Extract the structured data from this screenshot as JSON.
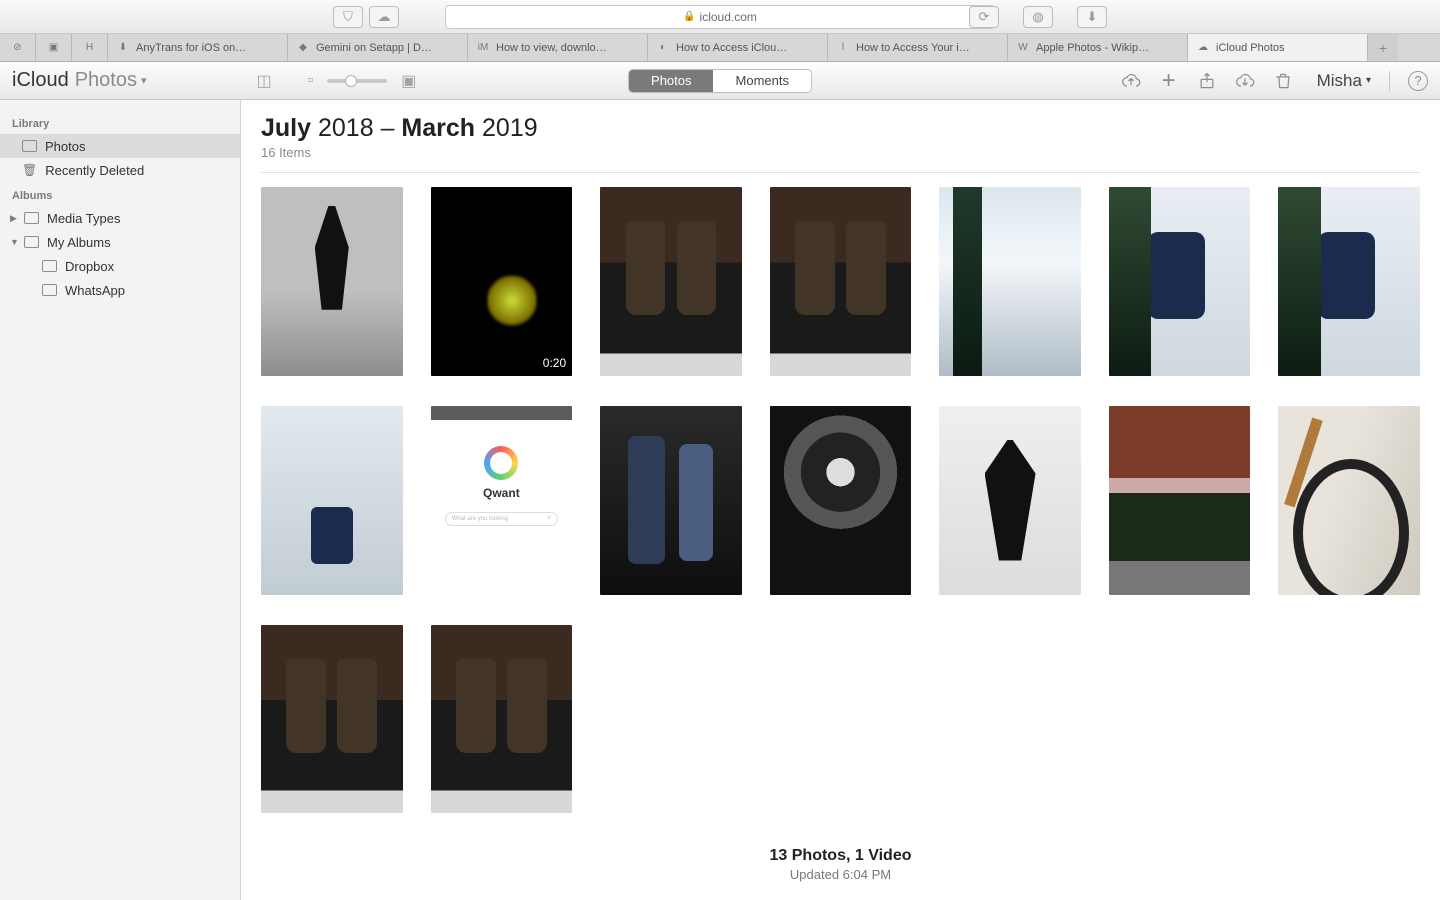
{
  "browser": {
    "url_host": "icloud.com",
    "tabs": [
      {
        "label": "",
        "icon": "⊘"
      },
      {
        "label": "",
        "icon": "▣"
      },
      {
        "label": "",
        "icon": "H"
      },
      {
        "label": "AnyTrans for iOS on…",
        "icon": "⬇"
      },
      {
        "label": "Gemini on Setapp | D…",
        "icon": "◆"
      },
      {
        "label": "How to view, downlo…",
        "icon": "iM"
      },
      {
        "label": "How to Access iClou…",
        "icon": "◐"
      },
      {
        "label": "How to Access Your i…",
        "icon": "l"
      },
      {
        "label": "Apple Photos - Wikip…",
        "icon": "W"
      },
      {
        "label": "iCloud Photos",
        "icon": "☁",
        "active": true
      }
    ]
  },
  "app": {
    "brand": "iCloud",
    "section": "Photos",
    "segmented": {
      "photos": "Photos",
      "moments": "Moments"
    },
    "user": "Misha"
  },
  "sidebar": {
    "library_label": "Library",
    "photos": "Photos",
    "recently_deleted": "Recently Deleted",
    "albums_label": "Albums",
    "media_types": "Media Types",
    "my_albums": "My Albums",
    "children": [
      {
        "label": "Dropbox"
      },
      {
        "label": "WhatsApp"
      }
    ]
  },
  "range": {
    "m1": "July",
    "y1": "2018",
    "dash": "–",
    "m2": "March",
    "y2": "2019",
    "count": "16 Items"
  },
  "thumbs": [
    {
      "style": "t-bw-steps"
    },
    {
      "style": "t-dark",
      "badge": "0:20"
    },
    {
      "style": "t-boots"
    },
    {
      "style": "t-boots"
    },
    {
      "style": "t-snow1"
    },
    {
      "style": "t-snow2"
    },
    {
      "style": "t-snow2"
    },
    {
      "style": "t-snow3"
    },
    {
      "style": "t-qwant"
    },
    {
      "style": "t-couple"
    },
    {
      "style": "t-moto"
    },
    {
      "style": "t-man"
    },
    {
      "style": "t-car"
    },
    {
      "style": "t-bike"
    },
    {
      "style": "t-boots"
    },
    {
      "style": "t-boots"
    }
  ],
  "qwant": {
    "name": "Qwant",
    "placeholder": "What are you looking"
  },
  "footer": {
    "summary": "13 Photos, 1 Video",
    "updated": "Updated 6:04 PM"
  }
}
